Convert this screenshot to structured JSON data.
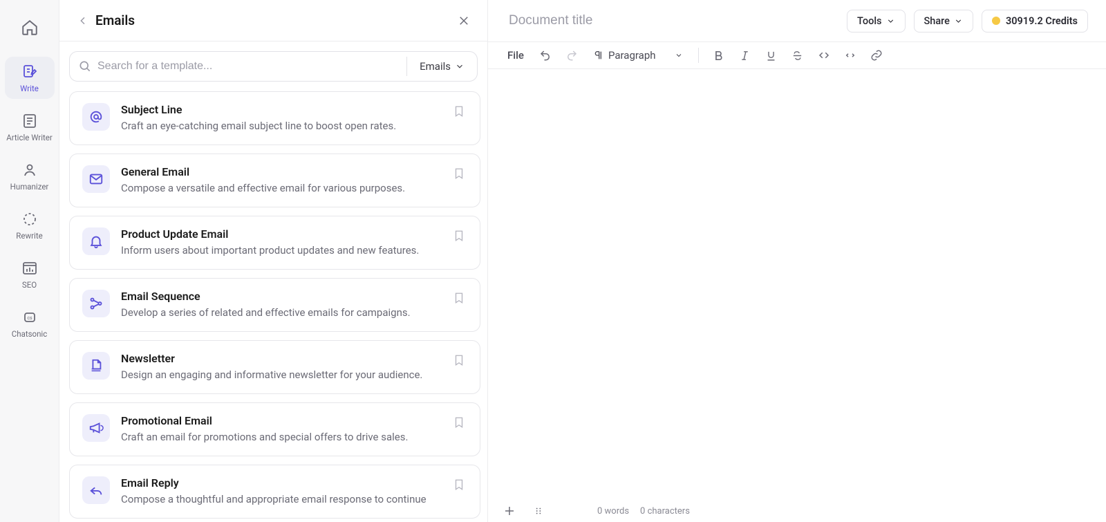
{
  "sidebar": {
    "items": [
      {
        "label": "Write"
      },
      {
        "label": "Article Writer"
      },
      {
        "label": "Humanizer"
      },
      {
        "label": "Rewrite"
      },
      {
        "label": "SEO"
      },
      {
        "label": "Chatsonic"
      }
    ]
  },
  "panel": {
    "title": "Emails",
    "search_placeholder": "Search for a template...",
    "filter_label": "Emails",
    "templates": [
      {
        "title": "Subject Line",
        "desc": "Craft an eye-catching email subject line to boost open rates."
      },
      {
        "title": "General Email",
        "desc": "Compose a versatile and effective email for various purposes."
      },
      {
        "title": "Product Update Email",
        "desc": "Inform users about important product updates and new features."
      },
      {
        "title": "Email Sequence",
        "desc": "Develop a series of related and effective emails for campaigns."
      },
      {
        "title": "Newsletter",
        "desc": "Design an engaging and informative newsletter for your audience."
      },
      {
        "title": "Promotional Email",
        "desc": "Craft an email for promotions and special offers to drive sales."
      },
      {
        "title": "Email Reply",
        "desc": "Compose a thoughtful and appropriate email response to continue"
      }
    ]
  },
  "editor": {
    "doc_title_placeholder": "Document title",
    "tools_label": "Tools",
    "share_label": "Share",
    "credits_label": "30919.2 Credits",
    "file_label": "File",
    "block_label": "Paragraph",
    "footer_words": "0 words",
    "footer_chars": "0 characters"
  }
}
